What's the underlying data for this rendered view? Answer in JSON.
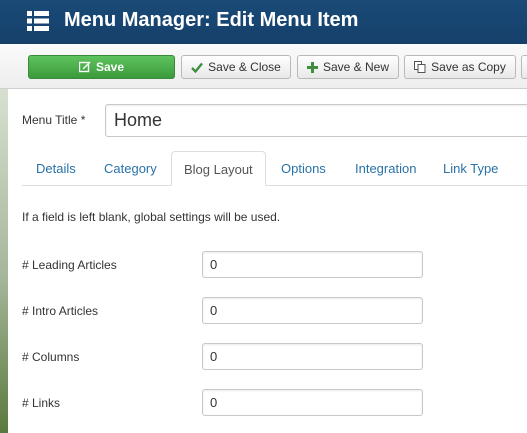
{
  "header": {
    "title": "Menu Manager: Edit Menu Item",
    "icon": "menu-list-icon"
  },
  "toolbar": {
    "save": {
      "label": "Save",
      "icon": "edit-icon"
    },
    "save_close": {
      "label": "Save & Close",
      "icon": "checkmark-icon"
    },
    "save_new": {
      "label": "Save & New",
      "icon": "plus-icon"
    },
    "save_copy": {
      "label": "Save as Copy",
      "icon": "copy-icon"
    }
  },
  "form": {
    "menu_title_label": "Menu Title *",
    "menu_title_value": "Home"
  },
  "tabs": [
    {
      "label": "Details",
      "active": false
    },
    {
      "label": "Category",
      "active": false
    },
    {
      "label": "Blog Layout",
      "active": true
    },
    {
      "label": "Options",
      "active": false
    },
    {
      "label": "Integration",
      "active": false
    },
    {
      "label": "Link Type",
      "active": false
    }
  ],
  "blog_layout": {
    "notice": "If a field is left blank, global settings will be used.",
    "fields": [
      {
        "label": "# Leading Articles",
        "value": "0"
      },
      {
        "label": "# Intro Articles",
        "value": "0"
      },
      {
        "label": "# Columns",
        "value": "0"
      },
      {
        "label": "# Links",
        "value": "0"
      }
    ]
  },
  "colors": {
    "header_bg": "#15406a",
    "save_green": "#46a546",
    "tab_link": "#2a72a8"
  }
}
